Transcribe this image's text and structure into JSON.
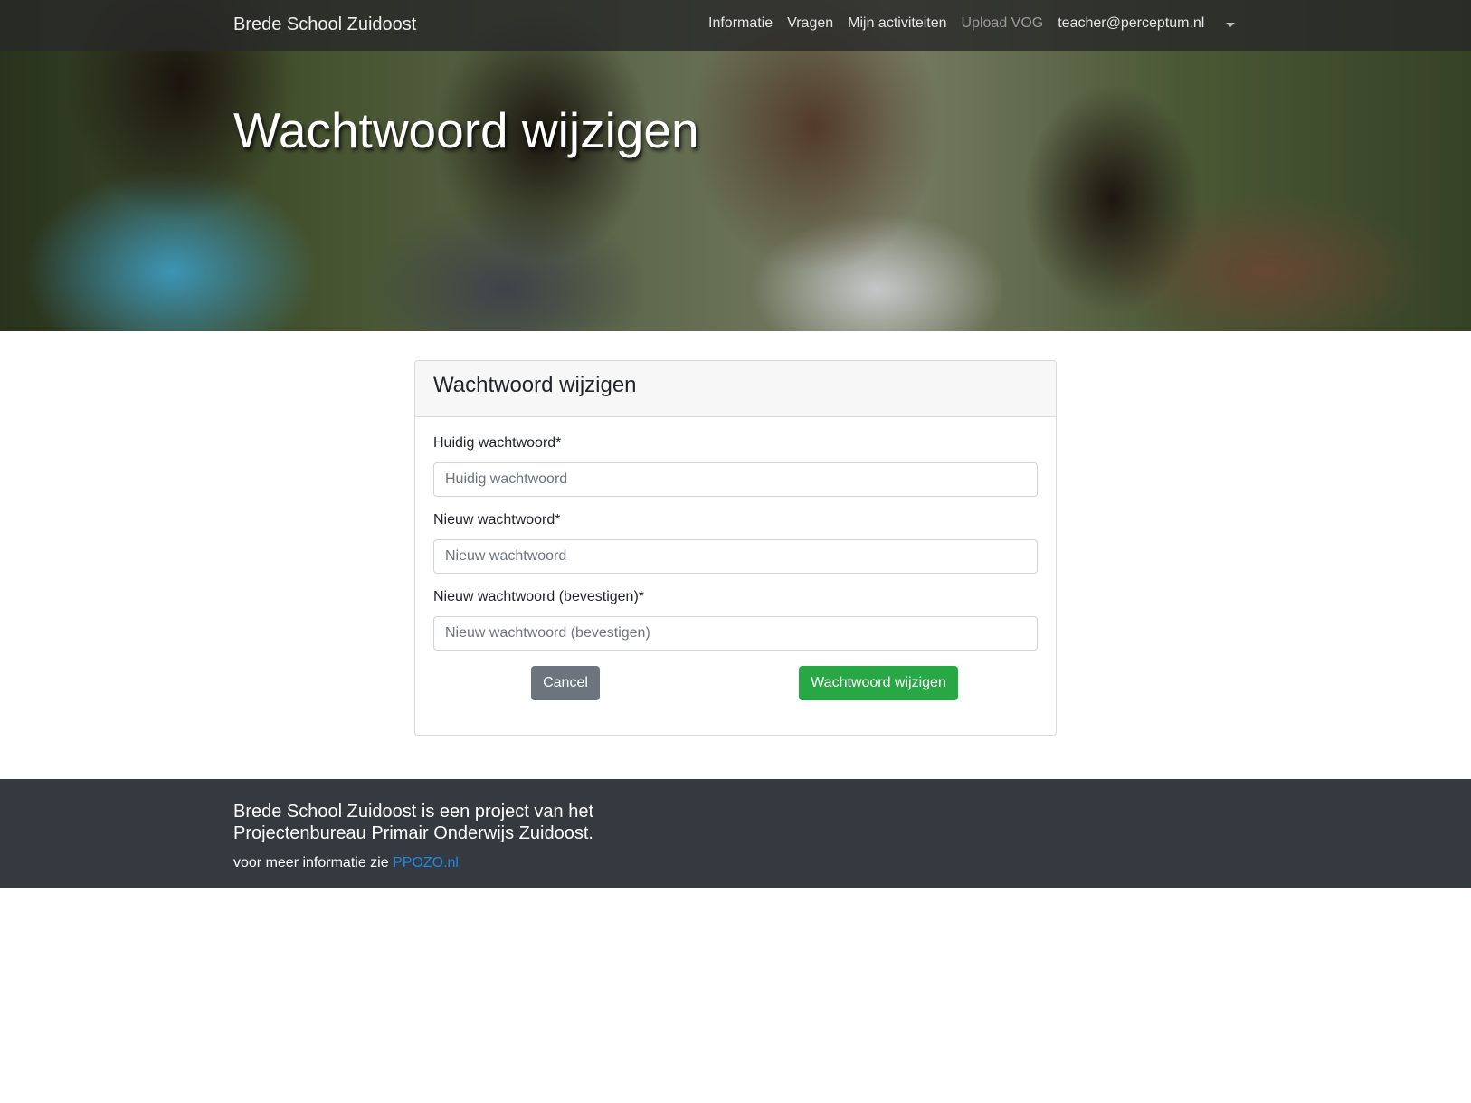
{
  "navbar": {
    "brand": "Brede School Zuidoost",
    "items": [
      {
        "label": "Informatie"
      },
      {
        "label": "Vragen"
      },
      {
        "label": "Mijn activiteiten"
      },
      {
        "label": "Upload VOG"
      },
      {
        "label": "teacher@perceptum.nl"
      }
    ]
  },
  "hero": {
    "title": "Wachtwoord wijzigen"
  },
  "card": {
    "title": "Wachtwoord wijzigen",
    "fields": [
      {
        "label": "Huidig wachtwoord*",
        "placeholder": "Huidig wachtwoord",
        "value": ""
      },
      {
        "label": "Nieuw wachtwoord*",
        "placeholder": "Nieuw wachtwoord",
        "value": ""
      },
      {
        "label": "Nieuw wachtwoord (bevestigen)*",
        "placeholder": "Nieuw wachtwoord (bevestigen)",
        "value": ""
      }
    ],
    "cancel_label": "Cancel",
    "submit_label": "Wachtwoord wijzigen"
  },
  "footer": {
    "line1": "Brede School Zuidoost is een project van het",
    "line2": "Projectenbureau Primair Onderwijs Zuidoost.",
    "info_prefix": "voor meer informatie zie",
    "link_text": "PPOZO.nl"
  },
  "colors": {
    "navbar_bg": "#282828",
    "footer_bg": "#343a40",
    "submit_green": "#28a745",
    "cancel_gray": "#6c757d",
    "link_blue": "#1e88e5"
  }
}
